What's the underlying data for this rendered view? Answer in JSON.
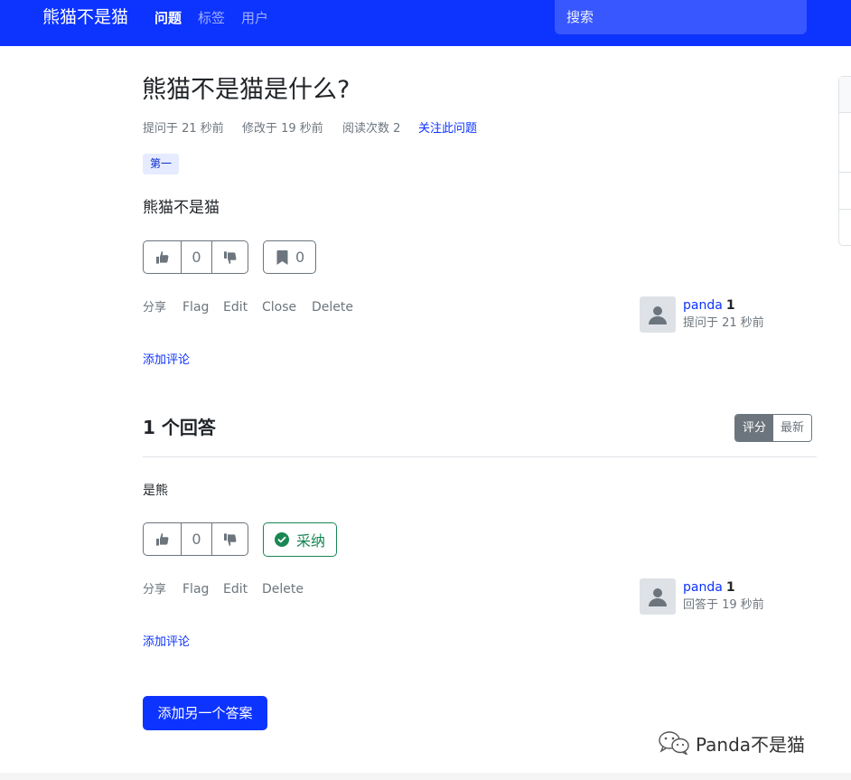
{
  "nav": {
    "brand": "熊猫不是猫",
    "links": [
      {
        "label": "问题",
        "active": true
      },
      {
        "label": "标签",
        "active": false
      },
      {
        "label": "用户",
        "active": false
      }
    ],
    "search_placeholder": "搜索"
  },
  "question": {
    "title": "熊猫不是猫是什么?",
    "asked": "提问于 21 秒前",
    "modified": "修改于 19 秒前",
    "views": "阅读次数 2",
    "follow_label": "关注此问题",
    "tag": "第一",
    "body": "熊猫不是猫",
    "votes": "0",
    "bookmarks": "0",
    "actions": {
      "share": "分享",
      "flag": "Flag",
      "edit": "Edit",
      "close": "Close",
      "delete": "Delete"
    },
    "author": {
      "name": "panda",
      "reputation": "1",
      "time": "提问于 21 秒前"
    },
    "add_comment": "添加评论"
  },
  "answers_section": {
    "heading": "1 个回答",
    "sort_options": [
      "评分",
      "最新"
    ],
    "active_sort": "评分"
  },
  "answer": {
    "body": "是熊",
    "votes": "0",
    "accept_label": "采纳",
    "actions": {
      "share": "分享",
      "flag": "Flag",
      "edit": "Edit",
      "delete": "Delete"
    },
    "author": {
      "name": "panda",
      "reputation": "1",
      "time": "回答于 19 秒前"
    },
    "add_comment": "添加评论"
  },
  "add_answer_label": "添加另一个答案",
  "watermark": "Panda不是猫",
  "colors": {
    "primary": "#0d33ff",
    "secondary": "#6c757d",
    "success": "#198754",
    "tag_bg": "#e6ebff"
  },
  "icons": [
    "thumbs-up-icon",
    "thumbs-down-icon",
    "bookmark-icon",
    "check-circle-icon",
    "user-icon",
    "wechat-icon"
  ]
}
